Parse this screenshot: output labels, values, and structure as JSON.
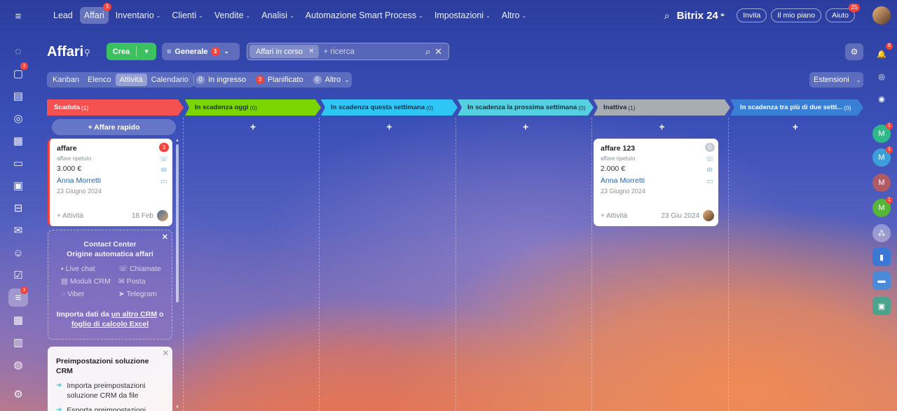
{
  "topbar": {
    "nav": [
      {
        "label": "Lead",
        "chevron": false
      },
      {
        "label": "Affari",
        "chevron": false,
        "badge": "3",
        "active": true
      },
      {
        "label": "Inventario",
        "chevron": true
      },
      {
        "label": "Clienti",
        "chevron": true
      },
      {
        "label": "Vendite",
        "chevron": true
      },
      {
        "label": "Analisi",
        "chevron": true
      },
      {
        "label": "Automazione Smart Process",
        "chevron": true
      },
      {
        "label": "Impostazioni",
        "chevron": true
      },
      {
        "label": "Altro",
        "chevron": true
      }
    ],
    "brand": "Bitrix 24",
    "invite_label": "Invita",
    "plan_label": "Il mio piano",
    "help_label": "Aiuto",
    "help_badge": "25"
  },
  "left_rail": {
    "badges": {
      "chat": "3",
      "crm": "3"
    }
  },
  "right_rail": {
    "notification_badge": "8",
    "avatars": [
      {
        "letter": "M",
        "color": "#2eb88a",
        "badge": "1"
      },
      {
        "letter": "M",
        "color": "#3d9fd9",
        "badge": "1"
      },
      {
        "letter": "M",
        "color": "#b05a66",
        "badge": ""
      },
      {
        "letter": "M",
        "color": "#55b536",
        "badge": "1"
      }
    ]
  },
  "header": {
    "title": "Affari",
    "create_label": "Crea",
    "filter_label": "Generale",
    "filter_badge": "3",
    "search_chip": "Affari in corso",
    "search_placeholder": "+ ricerca"
  },
  "views": {
    "tabs": [
      "Kanban",
      "Elenco",
      "Attività",
      "Calendario"
    ],
    "active": "Attività"
  },
  "counters": [
    {
      "num": "0",
      "label": "In ingresso",
      "red": false
    },
    {
      "num": "3",
      "label": "Pianificato",
      "red": true
    },
    {
      "num": "0",
      "label": "Altro",
      "red": false
    }
  ],
  "extensions_label": "Estensioni",
  "columns": [
    {
      "title": "Scaduta",
      "count": "(1)",
      "color": "#f65151"
    },
    {
      "title": "In scadenza oggi",
      "count": "(0)",
      "color": "#7bd500"
    },
    {
      "title": "In scadenza questa settimana",
      "count": "(0)",
      "color": "#2fc6f6"
    },
    {
      "title": "In scadenza la prossima settimana",
      "count": "(0)",
      "color": "#55d0e0"
    },
    {
      "title": "Inattiva",
      "count": "(1)",
      "color": "#a8adb4"
    },
    {
      "title": "In scadenza tra più di due setti...",
      "count": "(0)",
      "color": "#3a7fd6"
    }
  ],
  "quick_deal_label": "+ Affare rapido",
  "cards": [
    {
      "title": "affare",
      "subtitle": "affare ripetuto",
      "amount": "3.000 €",
      "client": "Anna Morretti",
      "date": "23 Giugno 2024",
      "activity": "+ Attività",
      "activity_date": "18 Feb",
      "badge": "3",
      "badge_color": "#f4433a"
    },
    {
      "title": "affare 123",
      "subtitle": "affare ripetuto",
      "amount": "2.000 €",
      "client": "Anna Morretti",
      "date": "23 Giugno 2024",
      "activity": "+ Attività",
      "activity_date": "23 Giu 2024",
      "badge": "0",
      "badge_color": "#c9ccd0"
    }
  ],
  "contact_center": {
    "title1": "Contact Center",
    "title2": "Origine automatica affari",
    "channels": [
      "Live chat",
      "Chiamate",
      "Moduli CRM",
      "Posta",
      "Viber",
      "Telegram"
    ],
    "import_prefix": "Importa dati da",
    "import_link1": "un altro CRM",
    "import_mid": "o",
    "import_link2": "foglio di calcolo Excel"
  },
  "presets": {
    "title": "Preimpostazioni soluzione CRM",
    "items": [
      "Importa preimpostazioni soluzione CRM da file",
      "Esporta preimpostazioni"
    ]
  }
}
